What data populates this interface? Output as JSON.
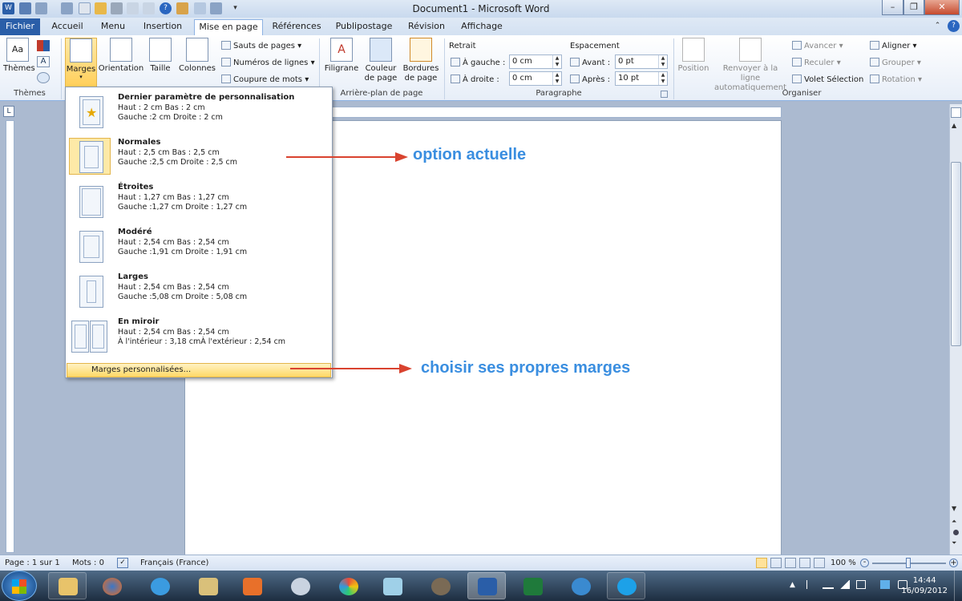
{
  "window": {
    "title": "Document1 - Microsoft Word"
  },
  "tabs": [
    "Fichier",
    "Accueil",
    "Menu",
    "Insertion",
    "Mise en page",
    "Références",
    "Publipostage",
    "Révision",
    "Affichage"
  ],
  "ribbon": {
    "themes": {
      "button": "Thèmes",
      "group": "Thèmes"
    },
    "margins_btn": "Marges",
    "orientation_btn": "Orientation",
    "size_btn": "Taille",
    "columns_btn": "Colonnes",
    "breaks": "Sauts de pages",
    "line_numbers": "Numéros de lignes",
    "hyphenation": "Coupure de mots",
    "watermark": "Filigrane",
    "page_color": "Couleur de page",
    "page_borders": "Bordures de page",
    "group_background": "Arrière-plan de page",
    "indent_label": "Retrait",
    "indent_left_label": "À gauche :",
    "indent_left_value": "0 cm",
    "indent_right_label": "À droite :",
    "indent_right_value": "0 cm",
    "spacing_label": "Espacement",
    "spacing_before_label": "Avant :",
    "spacing_before_value": "0 pt",
    "spacing_after_label": "Après :",
    "spacing_after_value": "10 pt",
    "group_paragraph": "Paragraphe",
    "position": "Position",
    "wrap_text": "Renvoyer à la ligne automatiquement",
    "bring_forward": "Avancer",
    "send_backward": "Reculer",
    "selection_pane": "Volet Sélection",
    "align": "Aligner",
    "group_obj": "Grouper",
    "rotate": "Rotation",
    "group_arrange": "Organiser"
  },
  "margins_menu": {
    "items": [
      {
        "title": "Dernier paramètre de personnalisation",
        "line1": "Haut :     2 cm              Bas :         2 cm",
        "line2": "Gauche :2 cm              Droite :   2 cm"
      },
      {
        "title": "Normales",
        "line1": "Haut :     2,5 cm          Bas :        2,5 cm",
        "line2": "Gauche :2,5 cm          Droite :   2,5 cm"
      },
      {
        "title": "Étroites",
        "line1": "Haut :     1,27 cm        Bas :        1,27 cm",
        "line2": "Gauche :1,27 cm        Droite :   1,27 cm"
      },
      {
        "title": "Modéré",
        "line1": "Haut :     2,54 cm        Bas :        2,54 cm",
        "line2": "Gauche :1,91 cm        Droite :   1,91 cm"
      },
      {
        "title": "Larges",
        "line1": "Haut :     2,54 cm        Bas :        2,54 cm",
        "line2": "Gauche :5,08 cm        Droite :   5,08 cm"
      },
      {
        "title": "En miroir",
        "line1": "Haut :     2,54 cm        Bas :        2,54 cm",
        "line2": "À l'intérieur :              3,18 cmÀ l'extérieur :              2,54 cm"
      }
    ],
    "custom": "Marges personnalisées..."
  },
  "annotations": {
    "current": "option actuelle",
    "custom": "choisir ses propres marges"
  },
  "status": {
    "page": "Page : 1 sur 1",
    "words": "Mots : 0",
    "language": "Français (France)",
    "zoom": "100 %"
  },
  "clock": {
    "time": "14:44",
    "date": "16/09/2012"
  }
}
